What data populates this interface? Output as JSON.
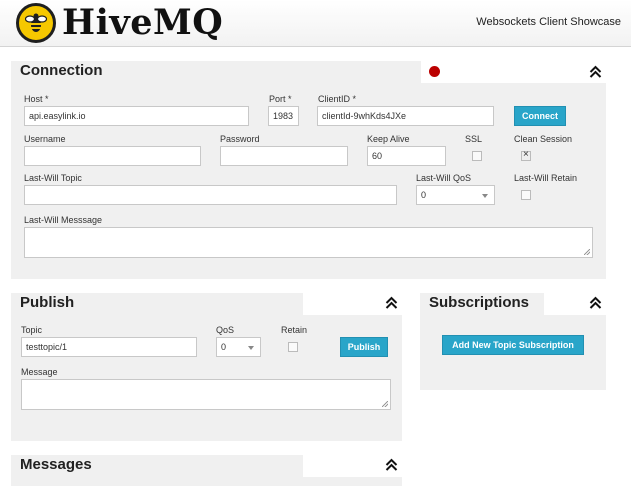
{
  "header": {
    "logo_text": "HiveMQ",
    "showcase": "Websockets Client Showcase"
  },
  "colors": {
    "accent_button": "#29a5c9",
    "status_disconnected": "#bb0000",
    "panel_bg": "#f0f0f0",
    "logo_yellow": "#f6c800"
  },
  "connection": {
    "title": "Connection",
    "status": "disconnected",
    "host_label": "Host *",
    "host_value": "api.easylink.io",
    "port_label": "Port *",
    "port_value": "1983",
    "clientid_label": "ClientID *",
    "clientid_value": "clientId-9whKds4JXe",
    "connect_label": "Connect",
    "username_label": "Username",
    "username_value": "",
    "password_label": "Password",
    "password_value": "",
    "keepalive_label": "Keep Alive",
    "keepalive_value": "60",
    "ssl_label": "SSL",
    "ssl_checked": false,
    "clean_session_label": "Clean Session",
    "clean_session_checked": true,
    "lwt_topic_label": "Last-Will Topic",
    "lwt_topic_value": "",
    "lwt_qos_label": "Last-Will QoS",
    "lwt_qos_value": "0",
    "lwt_retain_label": "Last-Will Retain",
    "lwt_retain_checked": false,
    "lwt_message_label": "Last-Will Messsage",
    "lwt_message_value": ""
  },
  "publish": {
    "title": "Publish",
    "topic_label": "Topic",
    "topic_value": "testtopic/1",
    "qos_label": "QoS",
    "qos_value": "0",
    "retain_label": "Retain",
    "retain_checked": false,
    "publish_label": "Publish",
    "message_label": "Message",
    "message_value": ""
  },
  "subscriptions": {
    "title": "Subscriptions",
    "add_label": "Add New Topic Subscription"
  },
  "messages": {
    "title": "Messages"
  },
  "icons": {
    "collapse": "double-chevron-up-icon",
    "logo": "bee-icon"
  }
}
